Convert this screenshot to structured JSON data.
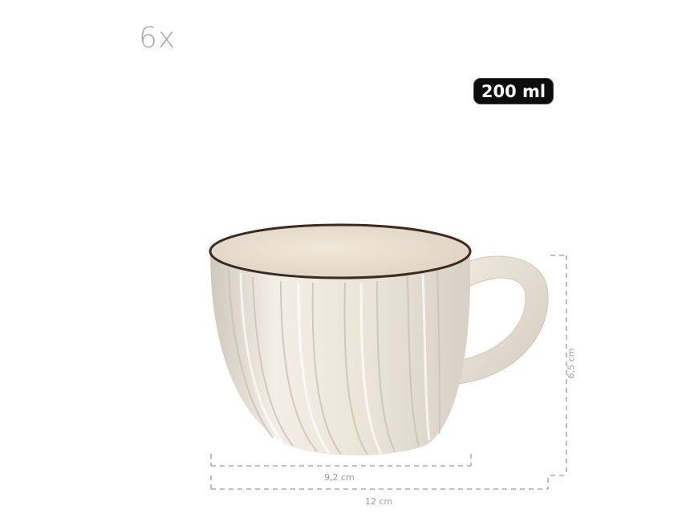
{
  "product": {
    "quantity": "6x",
    "volume": "200 ml"
  },
  "dimensions": {
    "inner_width": "9,2 cm",
    "outer_width": "12 cm",
    "height": "6,5 cm"
  },
  "colors": {
    "background": "#ffffff",
    "badge_bg": "#0d0d0d",
    "cup_body": "#ece6dc",
    "cup_rim": "#3a2a22",
    "dimension_lines": "#9a9a9a"
  }
}
